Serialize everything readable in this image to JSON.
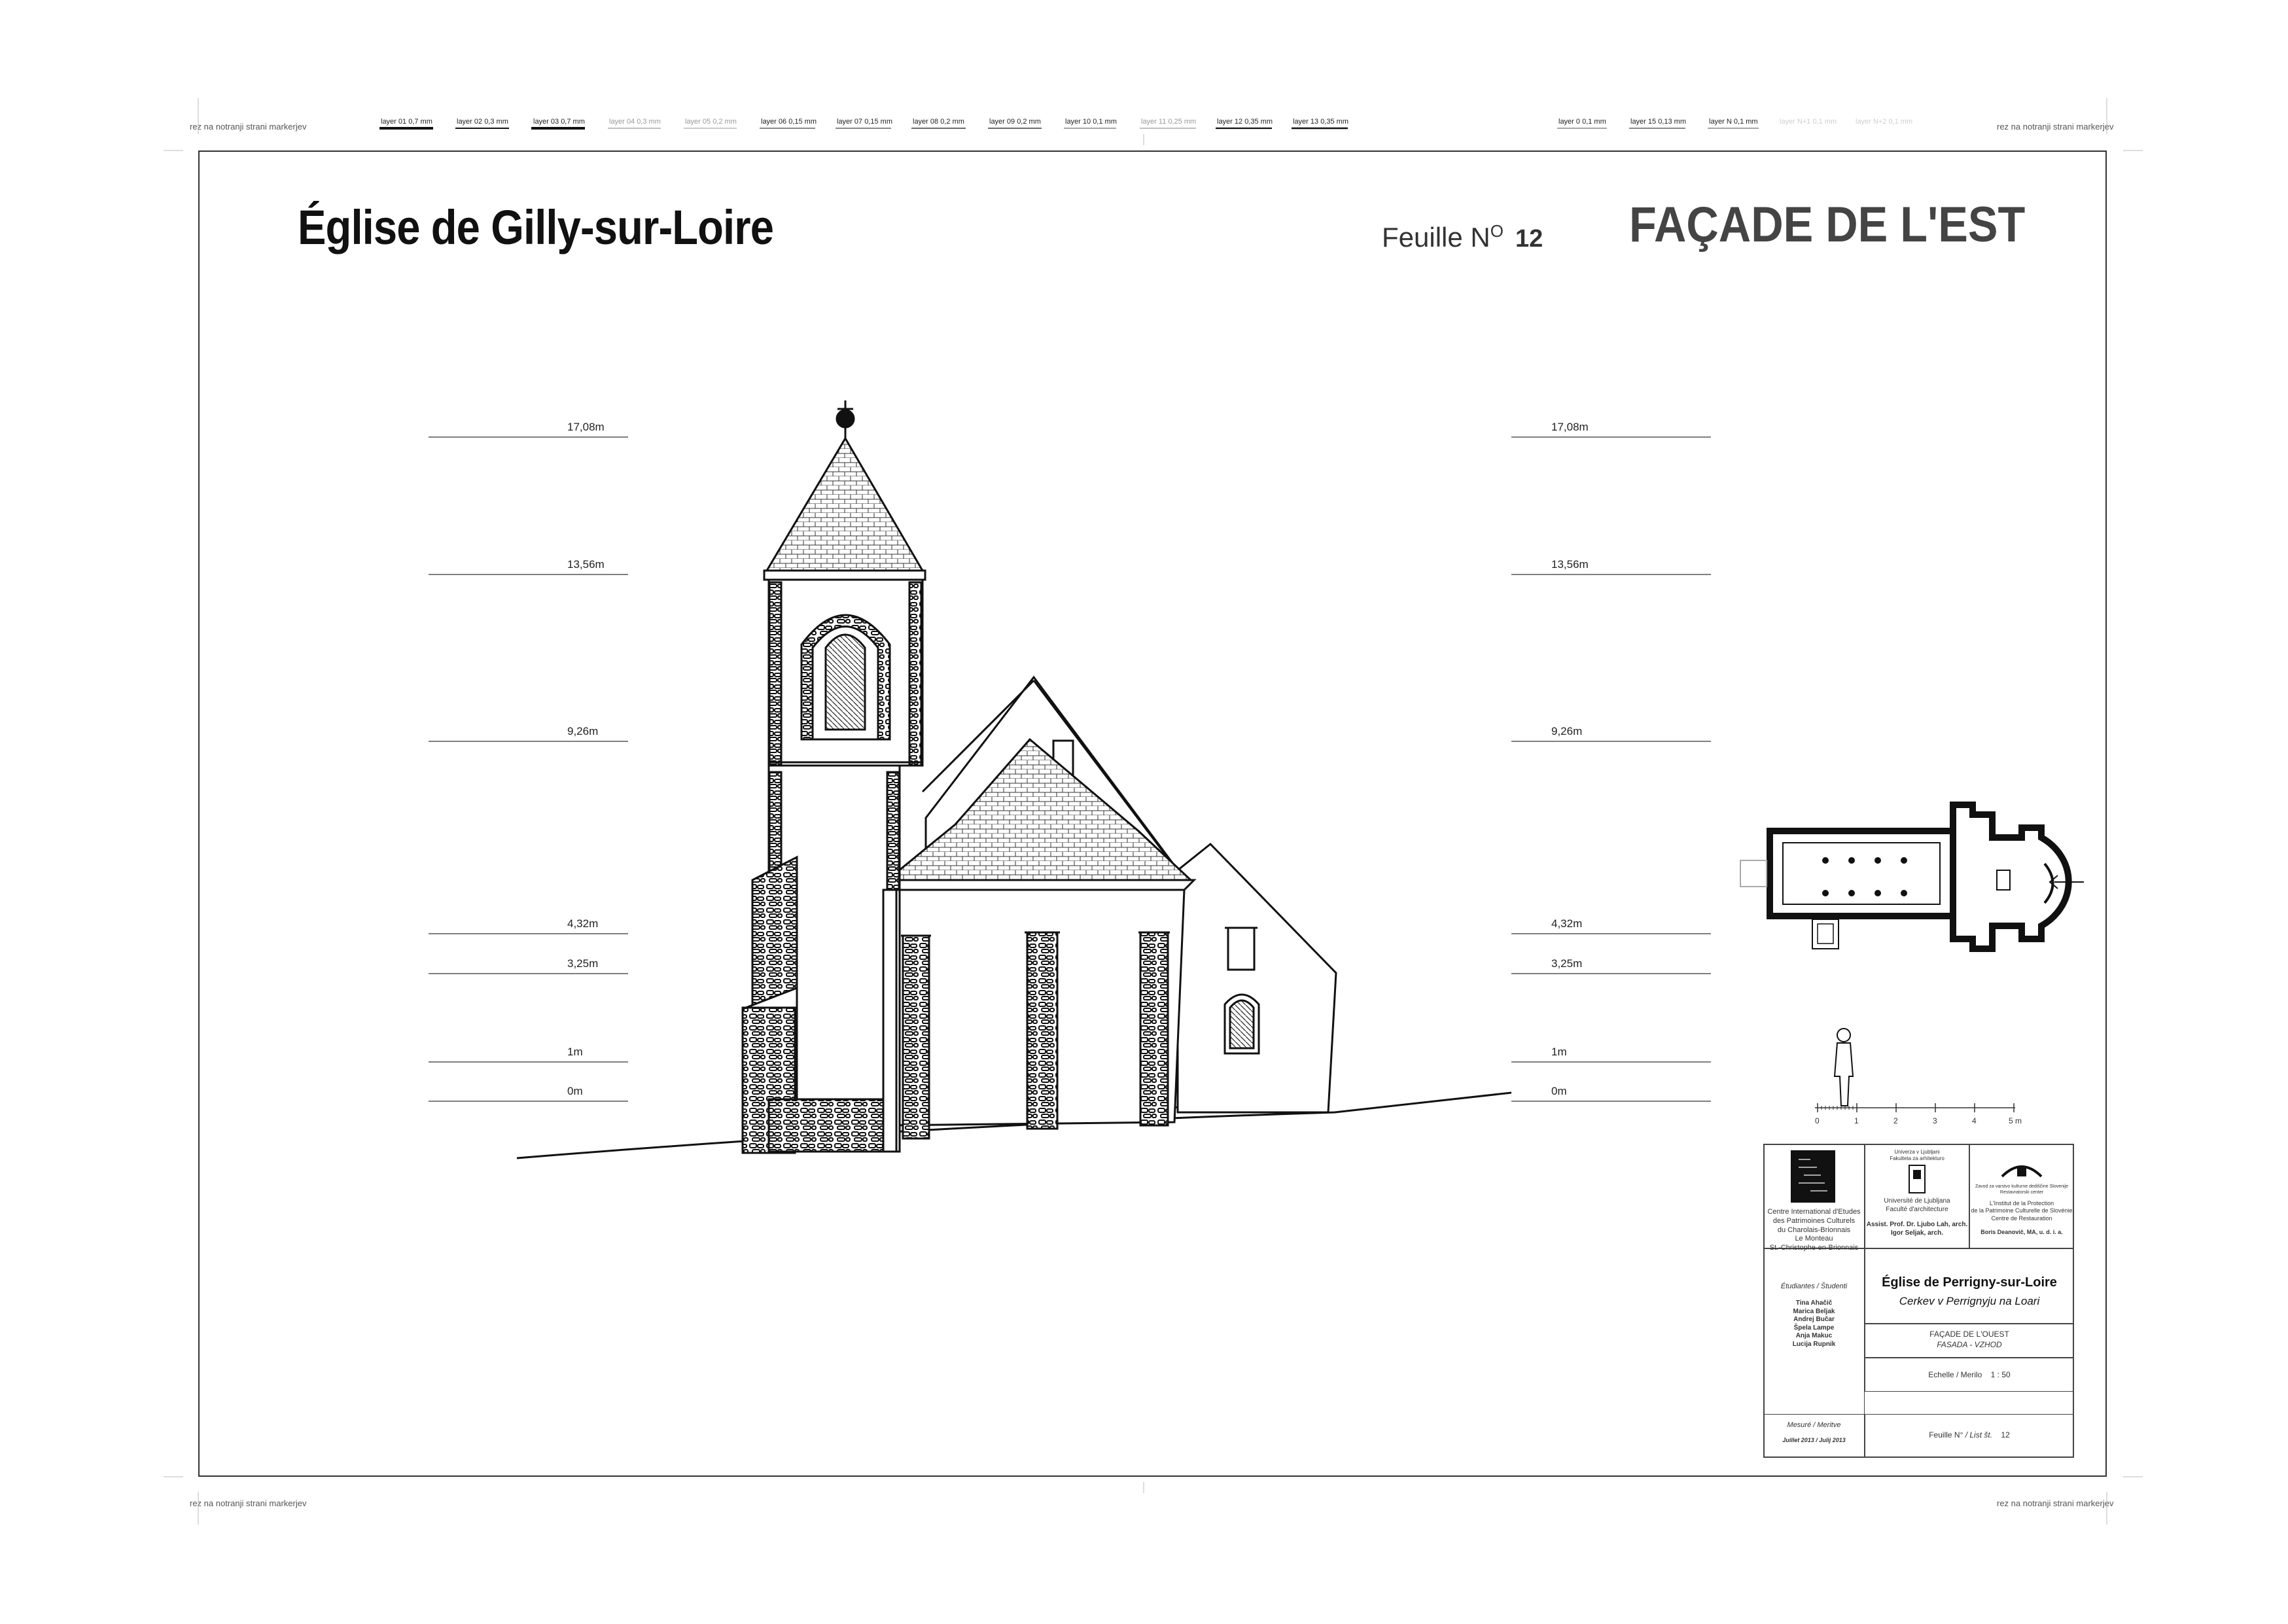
{
  "markers": {
    "top_left": "rez na notranji strani markerjev",
    "top_right": "rez na notranji strani markerjev",
    "bottom_left": "rez na notranji strani markerjev",
    "bottom_right": "rez na notranji strani markerjev"
  },
  "layers": [
    {
      "label": "layer 01  0,7 mm",
      "tone": "dark"
    },
    {
      "label": "layer 02  0,3 mm",
      "tone": "dark"
    },
    {
      "label": "layer 03  0,7 mm",
      "tone": "dark"
    },
    {
      "label": "layer 04  0,3 mm",
      "tone": "light"
    },
    {
      "label": "layer 05  0,2 mm",
      "tone": "light"
    },
    {
      "label": "layer 06  0,15 mm",
      "tone": "dark"
    },
    {
      "label": "layer 07  0,15 mm",
      "tone": "dark"
    },
    {
      "label": "layer 08  0,2 mm",
      "tone": "dark"
    },
    {
      "label": "layer 09  0,2 mm",
      "tone": "dark"
    },
    {
      "label": "layer 10  0,1 mm",
      "tone": "dark"
    },
    {
      "label": "layer 11  0,25 mm",
      "tone": "light"
    },
    {
      "label": "layer 12  0,35 mm",
      "tone": "dark"
    },
    {
      "label": "layer 13  0,35 mm",
      "tone": "dark"
    },
    {
      "label": "layer 0  0,1 mm",
      "tone": "dark"
    },
    {
      "label": "layer 15  0,13 mm",
      "tone": "dark"
    },
    {
      "label": "layer N  0,1 mm",
      "tone": "dark"
    },
    {
      "label": "layer N+1  0,1 mm",
      "tone": "faint"
    },
    {
      "label": "layer N+2  0,1 mm",
      "tone": "faint"
    }
  ],
  "header": {
    "title": "Église de Gilly-sur-Loire",
    "sheet_label": "Feuille N",
    "sheet_sup": "O",
    "sheet_number": "12",
    "facade": "FAÇADE DE L'EST"
  },
  "levels": [
    "17,08m",
    "13,56m",
    "9,26m",
    "4,32m",
    "3,25m",
    "1m",
    "0m"
  ],
  "scale_bar": {
    "ticks": [
      "0",
      "1",
      "2",
      "3",
      "4",
      "5 m"
    ]
  },
  "title_block": {
    "logo1_text": [
      "Centre International d'Etudes",
      "des Patrimoines Culturels",
      "du Charolais-Brionnais",
      "Le Monteau",
      "St.-Christophe-en-Brionnais"
    ],
    "logo2_top": [
      "Univerza v Ljubljani",
      "Fakulteta za arhitekturo"
    ],
    "logo2_text": [
      "Université de Ljubljana",
      "Faculté d'architecture"
    ],
    "logo2_people": [
      "Assist. Prof. Dr. Ljubo Lah, arch.",
      "Igor Seljak, arch."
    ],
    "logo3_top": [
      "Zavod za varstvo kulturne dediščine Slovenije",
      "Restavratorski center"
    ],
    "logo3_text": [
      "L'Institut de la Protection",
      "de la Patrimoine Culturelle de Slovénie",
      "Centre de Restauration"
    ],
    "logo3_person": "Boris Deanovič, MA, u. d. i. a.",
    "students_label": "Étudiantes / Študenti",
    "students": [
      "Tina Ahačič",
      "Marica Beljak",
      "Andrej Bučar",
      "Špela Lampe",
      "Anja Makuc",
      "Lucija Rupnik"
    ],
    "project_title": "Église de Perrigny-sur-Loire",
    "project_subtitle": "Cerkev v Perrignyju na Loari",
    "drawing_name": "FAÇADE DE L'OUEST",
    "drawing_name_sl": "FASADA - VZHOD",
    "scale_label": "Echelle / Merilo",
    "scale_value": "1 : 50",
    "survey_label": "Mesuré / Meritve",
    "survey_date": "Juillet 2013 / Julij 2013",
    "sheet_label": "Feuille N°",
    "sheet_label_sl": "/ List št.",
    "sheet_value": "12"
  }
}
